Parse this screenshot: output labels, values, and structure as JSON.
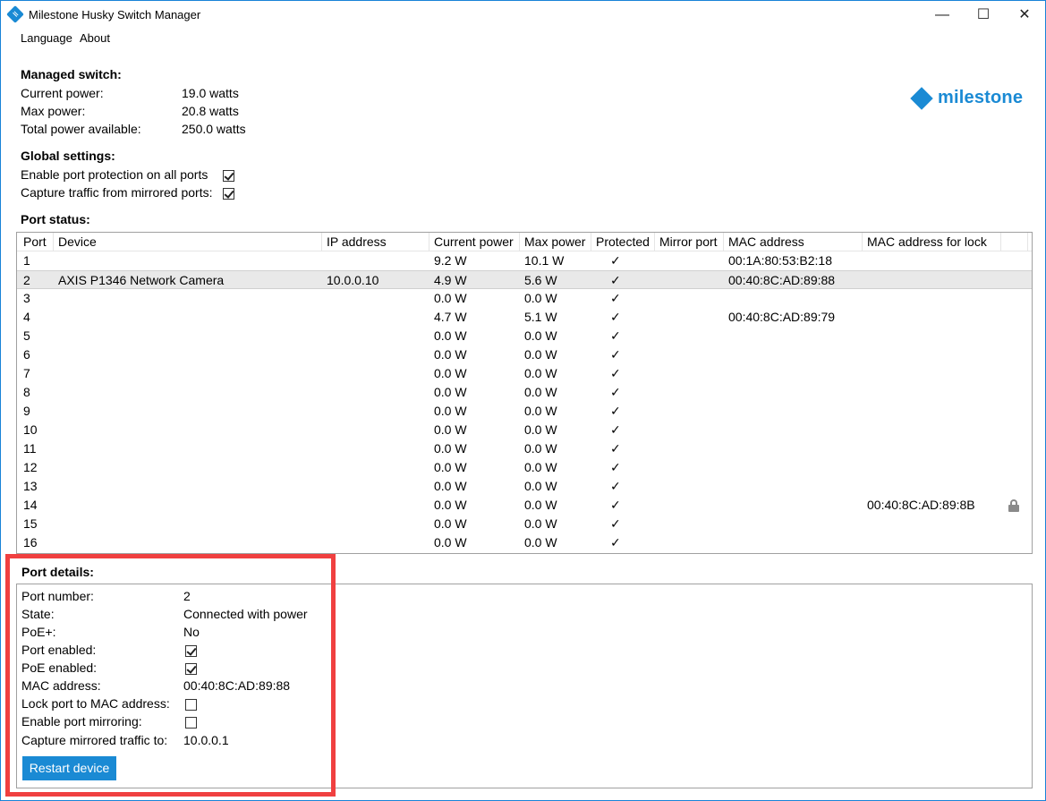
{
  "window": {
    "title": "Milestone Husky Switch Manager",
    "min_glyph": "—",
    "max_glyph": "☐",
    "close_glyph": "✕"
  },
  "menu": {
    "language": "Language",
    "about": "About"
  },
  "logo": {
    "text": "milestone",
    "color": "#1a8ad4"
  },
  "managed": {
    "heading": "Managed switch:",
    "rows": [
      {
        "label": "Current power:",
        "value": "19.0 watts"
      },
      {
        "label": "Max power:",
        "value": "20.8 watts"
      },
      {
        "label": "Total power available:",
        "value": "250.0 watts"
      }
    ]
  },
  "global": {
    "heading": "Global settings:",
    "protection_label": "Enable port protection on all ports",
    "protection_checked": true,
    "capture_label": "Capture traffic from mirrored ports:",
    "capture_checked": true
  },
  "port_status": {
    "heading": "Port status:",
    "columns": [
      "Port",
      "Device",
      "IP address",
      "Current power",
      "Max power",
      "Protected",
      "Mirror port",
      "MAC address",
      "MAC address for lock"
    ],
    "selected_row": 1,
    "rows": [
      {
        "port": "1",
        "device": "",
        "ip": "",
        "current": "9.2 W",
        "max": "10.1 W",
        "protected": "✓",
        "mirror": "",
        "mac": "00:1A:80:53:B2:18",
        "lockmac": "",
        "locked": false
      },
      {
        "port": "2",
        "device": "AXIS P1346 Network Camera",
        "ip": "10.0.0.10",
        "current": "4.9 W",
        "max": "5.6 W",
        "protected": "✓",
        "mirror": "",
        "mac": "00:40:8C:AD:89:88",
        "lockmac": "",
        "locked": false
      },
      {
        "port": "3",
        "device": "",
        "ip": "",
        "current": "0.0 W",
        "max": "0.0 W",
        "protected": "✓",
        "mirror": "",
        "mac": "",
        "lockmac": "",
        "locked": false
      },
      {
        "port": "4",
        "device": "",
        "ip": "",
        "current": "4.7 W",
        "max": "5.1 W",
        "protected": "✓",
        "mirror": "",
        "mac": "00:40:8C:AD:89:79",
        "lockmac": "",
        "locked": false
      },
      {
        "port": "5",
        "device": "",
        "ip": "",
        "current": "0.0 W",
        "max": "0.0 W",
        "protected": "✓",
        "mirror": "",
        "mac": "",
        "lockmac": "",
        "locked": false
      },
      {
        "port": "6",
        "device": "",
        "ip": "",
        "current": "0.0 W",
        "max": "0.0 W",
        "protected": "✓",
        "mirror": "",
        "mac": "",
        "lockmac": "",
        "locked": false
      },
      {
        "port": "7",
        "device": "",
        "ip": "",
        "current": "0.0 W",
        "max": "0.0 W",
        "protected": "✓",
        "mirror": "",
        "mac": "",
        "lockmac": "",
        "locked": false
      },
      {
        "port": "8",
        "device": "",
        "ip": "",
        "current": "0.0 W",
        "max": "0.0 W",
        "protected": "✓",
        "mirror": "",
        "mac": "",
        "lockmac": "",
        "locked": false
      },
      {
        "port": "9",
        "device": "",
        "ip": "",
        "current": "0.0 W",
        "max": "0.0 W",
        "protected": "✓",
        "mirror": "",
        "mac": "",
        "lockmac": "",
        "locked": false
      },
      {
        "port": "10",
        "device": "",
        "ip": "",
        "current": "0.0 W",
        "max": "0.0 W",
        "protected": "✓",
        "mirror": "",
        "mac": "",
        "lockmac": "",
        "locked": false
      },
      {
        "port": "11",
        "device": "",
        "ip": "",
        "current": "0.0 W",
        "max": "0.0 W",
        "protected": "✓",
        "mirror": "",
        "mac": "",
        "lockmac": "",
        "locked": false
      },
      {
        "port": "12",
        "device": "",
        "ip": "",
        "current": "0.0 W",
        "max": "0.0 W",
        "protected": "✓",
        "mirror": "",
        "mac": "",
        "lockmac": "",
        "locked": false
      },
      {
        "port": "13",
        "device": "",
        "ip": "",
        "current": "0.0 W",
        "max": "0.0 W",
        "protected": "✓",
        "mirror": "",
        "mac": "",
        "lockmac": "",
        "locked": false
      },
      {
        "port": "14",
        "device": "",
        "ip": "",
        "current": "0.0 W",
        "max": "0.0 W",
        "protected": "✓",
        "mirror": "",
        "mac": "",
        "lockmac": "00:40:8C:AD:89:8B",
        "locked": true
      },
      {
        "port": "15",
        "device": "",
        "ip": "",
        "current": "0.0 W",
        "max": "0.0 W",
        "protected": "✓",
        "mirror": "",
        "mac": "",
        "lockmac": "",
        "locked": false
      },
      {
        "port": "16",
        "device": "",
        "ip": "",
        "current": "0.0 W",
        "max": "0.0 W",
        "protected": "✓",
        "mirror": "",
        "mac": "",
        "lockmac": "",
        "locked": false
      }
    ]
  },
  "port_details": {
    "heading": "Port details:",
    "port_number_label": "Port number:",
    "port_number": "2",
    "state_label": "State:",
    "state": "Connected with power",
    "poe_plus_label": "PoE+:",
    "poe_plus": "No",
    "port_enabled_label": "Port enabled:",
    "port_enabled": true,
    "poe_enabled_label": "PoE enabled:",
    "poe_enabled": true,
    "mac_label": "MAC address:",
    "mac": "00:40:8C:AD:89:88",
    "lock_label": "Lock port to MAC address:",
    "lock": false,
    "mirroring_label": "Enable port mirroring:",
    "mirroring": false,
    "capture_label": "Capture mirrored traffic to:",
    "capture": "10.0.0.1",
    "restart_label": "Restart device"
  },
  "colors": {
    "accent": "#1a8ad4",
    "highlight": "#f04040",
    "selected_row": "#e9e9e9"
  }
}
